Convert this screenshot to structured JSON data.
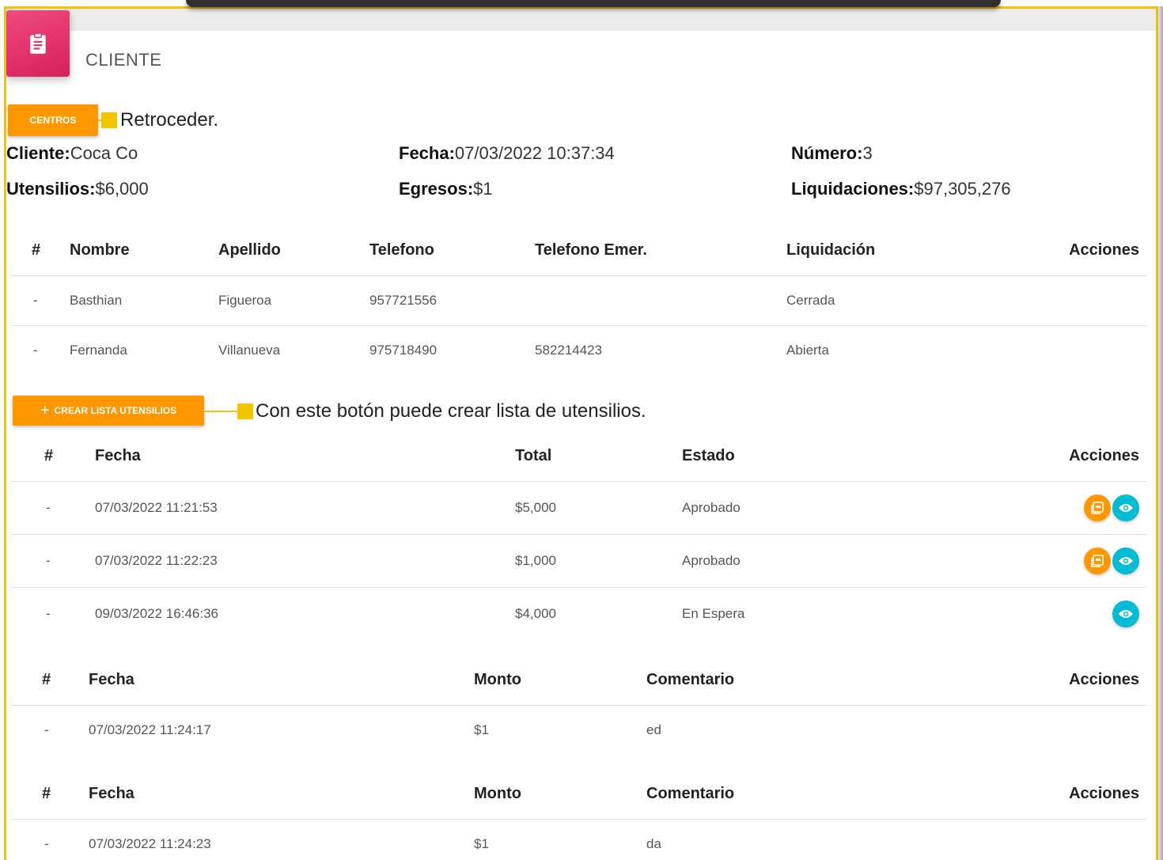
{
  "header": {
    "title": "CLIENTE",
    "icon": "clipboard-icon"
  },
  "back": {
    "button_label": "CENTROS",
    "callout": "Retroceder."
  },
  "info": {
    "cliente_label": "Cliente:",
    "cliente_value": "Coca Co",
    "fecha_label": "Fecha:",
    "fecha_value": "07/03/2022 10:37:34",
    "numero_label": "Número:",
    "numero_value": "3",
    "utensilios_label": "Utensilios:",
    "utensilios_value": "$6,000",
    "egresos_label": "Egresos:",
    "egresos_value": "$1",
    "liquidaciones_label": "Liquidaciones:",
    "liquidaciones_value": "$97,305,276"
  },
  "workers": {
    "headers": [
      "#",
      "Nombre",
      "Apellido",
      "Telefono",
      "Telefono Emer.",
      "Liquidación",
      "Acciones"
    ],
    "rows": [
      [
        "-",
        "Basthian",
        "Figueroa",
        "957721556",
        "",
        "Cerrada"
      ],
      [
        "-",
        "Fernanda",
        "Villanueva",
        "975718490",
        "582214423",
        "Abierta"
      ]
    ]
  },
  "create": {
    "button_label": "CREAR LISTA UTENSILIOS",
    "icon": "plus-icon",
    "callout": "Con este botón puede crear lista de utensilios."
  },
  "utensils": {
    "headers": [
      "#",
      "Fecha",
      "Total",
      "Estado",
      "Acciones"
    ],
    "rows": [
      [
        "-",
        "07/03/2022 11:21:53",
        "$5,000",
        "Aprobado"
      ],
      [
        "-",
        "07/03/2022 11:22:23",
        "$1,000",
        "Aprobado"
      ],
      [
        "-",
        "09/03/2022 16:46:36",
        "$4,000",
        "En Espera"
      ]
    ]
  },
  "egresos1": {
    "headers": [
      "#",
      "Fecha",
      "Monto",
      "Comentario",
      "Acciones"
    ],
    "rows": [
      [
        "-",
        "07/03/2022 11:24:17",
        "$1",
        "ed"
      ]
    ]
  },
  "egresos2": {
    "headers": [
      "#",
      "Fecha",
      "Monto",
      "Comentario",
      "Acciones"
    ],
    "rows": [
      [
        "-",
        "07/03/2022 11:24:23",
        "$1",
        "da"
      ]
    ]
  },
  "colors": {
    "accent_orange": "#ff9800",
    "accent_cyan": "#00bcd4",
    "header_pink": "#e91e63",
    "callout_yellow": "#f3c20c"
  }
}
